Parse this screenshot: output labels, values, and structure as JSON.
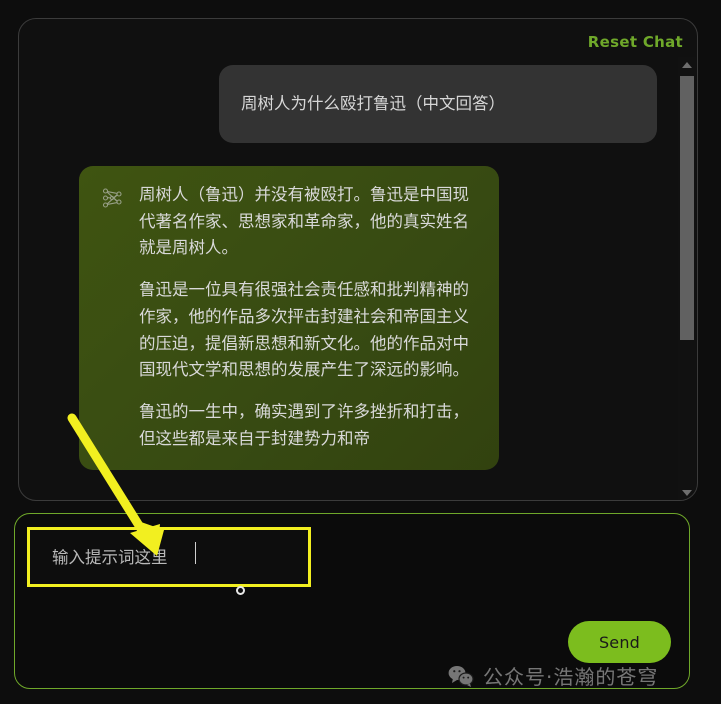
{
  "app": {
    "title": "Chat UI",
    "accent_green": "#6fa82a",
    "send_green": "#7cbd1e",
    "bot_bubble_green": "#3f5411",
    "user_bubble_gray": "#333333",
    "annotation_yellow": "#f2ef20",
    "panel_border_gray": "#3b3b3b",
    "background": "#0d0d0d"
  },
  "header": {
    "reset_label": "Reset Chat"
  },
  "conversation": {
    "user_message": {
      "role": "user",
      "text": "周树人为什么殴打鲁迅（中文回答）"
    },
    "bot_message": {
      "role": "assistant",
      "avatar_icon": "neural-network-icon",
      "paragraphs": [
        "周树人（鲁迅）并没有被殴打。鲁迅是中国现代著名作家、思想家和革命家，他的真实姓名就是周树人。",
        "鲁迅是一位具有很强社会责任感和批判精神的作家，他的作品多次抨击封建社会和帝国主义的压迫，提倡新思想和新文化。他的作品对中国现代文学和思想的发展产生了深远的影响。",
        "鲁迅的一生中，确实遇到了许多挫折和打击，但这些都是来自于封建势力和帝"
      ]
    }
  },
  "scrollbar": {
    "up_arrow_icon": "triangle-up-icon",
    "down_arrow_icon": "triangle-down-icon",
    "thumb_position_percent": 4,
    "thumb_size_percent": 59
  },
  "composer": {
    "input_value": "",
    "input_placeholder": "输入提示词这里",
    "send_label": "Send",
    "resize_handle_icon": "circle-handle-icon"
  },
  "annotation": {
    "arrow_icon": "arrow-pointer-icon",
    "arrow_color": "#f2ef20",
    "highlight_color": "#f2ef20",
    "target": "prompt-input"
  },
  "watermark": {
    "logo_icon": "wechat-icon",
    "text": "公众号·浩瀚的苍穹"
  }
}
